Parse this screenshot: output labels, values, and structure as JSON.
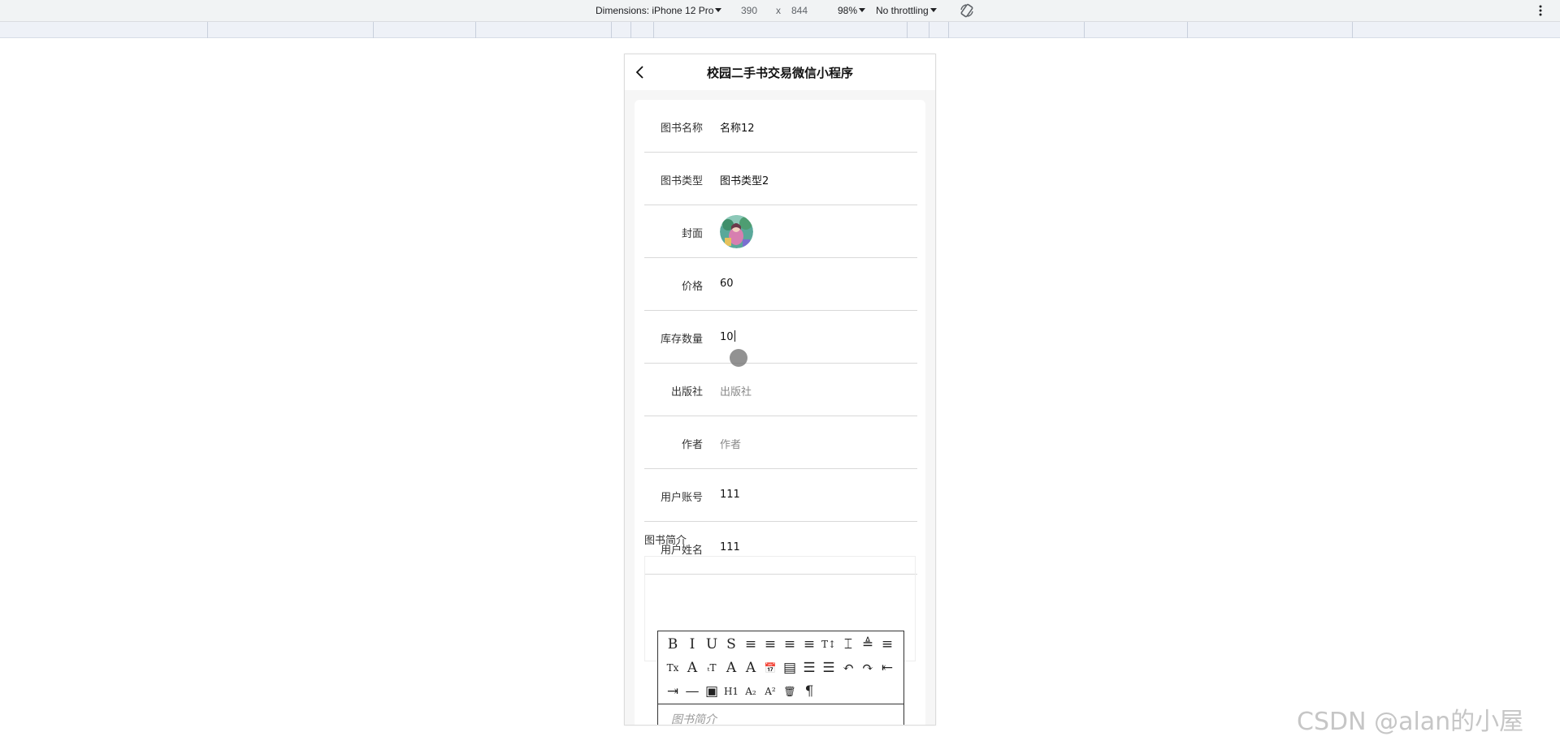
{
  "devtools": {
    "dimensions_label": "Dimensions: iPhone 12 Pro",
    "width": "390",
    "times": "x",
    "height": "844",
    "zoom": "98%",
    "throttling": "No throttling"
  },
  "app": {
    "title": "校园二手书交易微信小程序",
    "fields": [
      {
        "label": "图书名称",
        "value": "名称12",
        "placeholder": false
      },
      {
        "label": "图书类型",
        "value": "图书类型2",
        "placeholder": false
      },
      {
        "label": "封面",
        "value": "",
        "placeholder": false
      },
      {
        "label": "价格",
        "value": "60",
        "placeholder": false
      },
      {
        "label": "库存数量",
        "value": "10",
        "placeholder": false
      },
      {
        "label": "出版社",
        "value": "出版社",
        "placeholder": true
      },
      {
        "label": "作者",
        "value": "作者",
        "placeholder": true
      },
      {
        "label": "用户账号",
        "value": "111",
        "placeholder": false
      },
      {
        "label": "用户姓名",
        "value": "111",
        "placeholder": false
      }
    ],
    "intro_label": "图书简介",
    "editor_placeholder": "图书简介",
    "editor_tools": [
      "B",
      "I",
      "U",
      "S",
      "≡",
      "≡",
      "≡",
      "≡",
      "T↕",
      "⌶",
      "≜",
      "≡",
      "Tx",
      "A",
      "ₜT",
      "A",
      "A",
      "📅",
      "▤",
      "☰",
      "☰",
      "↶",
      "↷",
      "⇤",
      "⇥",
      "—",
      "▣",
      "H1",
      "A₂",
      "A²",
      "🗑",
      "¶"
    ]
  },
  "watermark": "CSDN @alan的小屋",
  "colors": {
    "toolbar_bg": "#f1f3f4",
    "page_bg": "#f6f6f6",
    "divider": "#d9d9d9"
  }
}
